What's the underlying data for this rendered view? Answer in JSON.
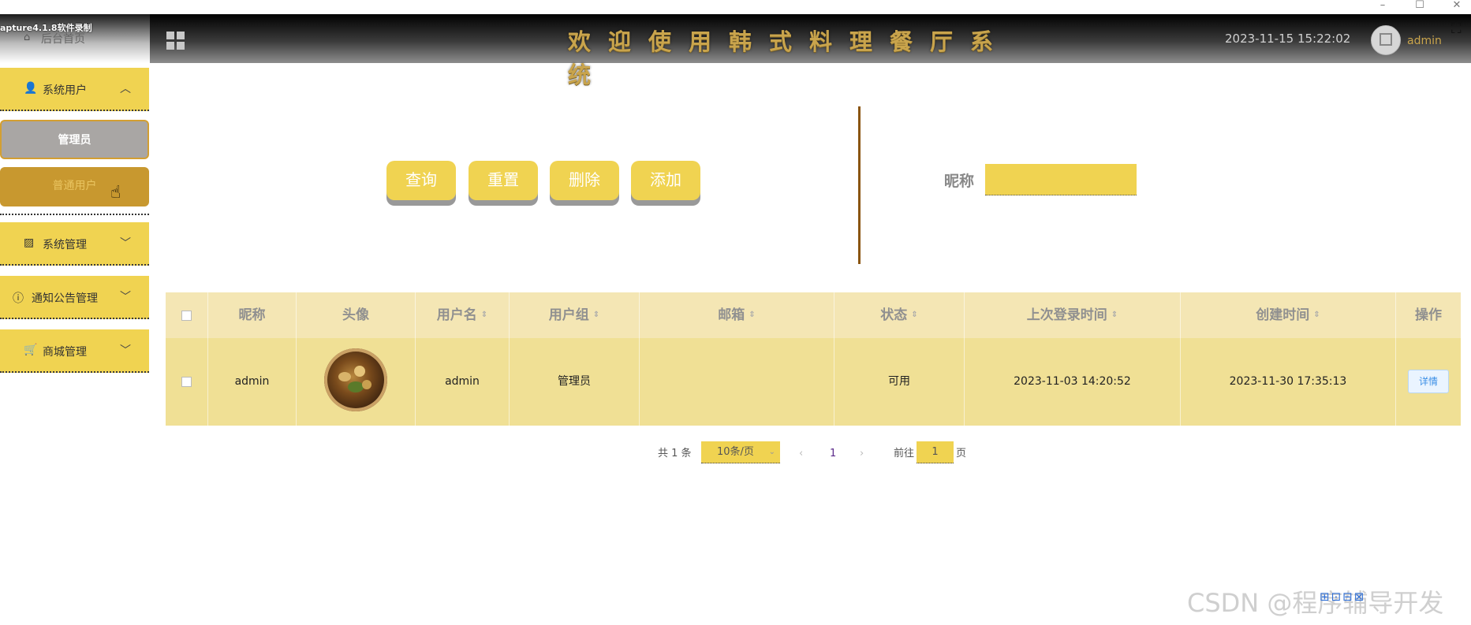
{
  "recorder_label": "apture4.1.8软件录制",
  "window_controls": [
    "–",
    "☐",
    "✕"
  ],
  "header": {
    "home_label": "后台首页",
    "title": "欢迎使用韩式料理餐厅系统",
    "datetime": "2023-11-15 15:22:02",
    "username": "admin"
  },
  "sidebar": {
    "groups": [
      {
        "label": "系统用户",
        "icon": "user-icon",
        "expanded": true
      },
      {
        "label": "系统管理",
        "icon": "image-icon",
        "expanded": false
      },
      {
        "label": "通知公告管理",
        "icon": "info-icon",
        "expanded": false
      },
      {
        "label": "商城管理",
        "icon": "cart-icon",
        "expanded": false
      }
    ],
    "sub_items": [
      {
        "label": "管理员"
      },
      {
        "label": "普通用户"
      }
    ]
  },
  "toolbar": {
    "query_label": "查询",
    "reset_label": "重置",
    "delete_label": "删除",
    "add_label": "添加"
  },
  "search": {
    "nickname_label": "昵称",
    "nickname_value": ""
  },
  "table": {
    "headers": [
      "昵称",
      "头像",
      "用户名",
      "用户组",
      "邮箱",
      "状态",
      "上次登录时间",
      "创建时间",
      "操作"
    ],
    "rows": [
      {
        "nickname": "admin",
        "username": "admin",
        "group": "管理员",
        "email": "",
        "status": "可用",
        "last_login": "2023-11-03 14:20:52",
        "created": "2023-11-30 17:35:13",
        "action": "详情"
      }
    ]
  },
  "pagination": {
    "total_text": "共 1 条",
    "page_size": "10条/页",
    "current_page": "1",
    "goto_prefix": "前往",
    "goto_value": "1",
    "goto_suffix": "页"
  },
  "watermark": "CSDN @程序辅导开发",
  "colors": {
    "accent": "#f0d351",
    "accent_dark": "#c8982f",
    "table_header_bg": "#f4e6b4",
    "table_row_bg": "#f0e095"
  }
}
